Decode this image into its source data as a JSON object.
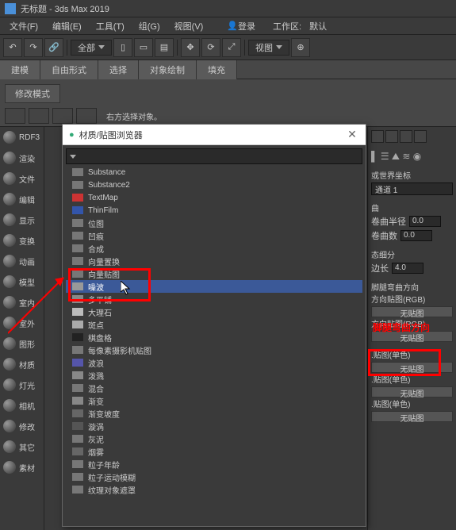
{
  "window": {
    "title": "无标题 - 3ds Max 2019"
  },
  "menu": {
    "file": "文件(F)",
    "edit": "编辑(E)",
    "tools": "工具(T)",
    "group": "组(G)",
    "views": "视图(V)",
    "login": "登录",
    "workspace": "工作区:",
    "default": "默认"
  },
  "toolbar": {
    "all_dropdown": "全部",
    "view_dropdown": "视图"
  },
  "ribbon": {
    "tab_build": "建模",
    "tab_freeform": "自由形式",
    "tab_select": "选择",
    "tab_objcontrol": "对象绘制",
    "tab_fill": "填充",
    "mod_mode": "修改模式",
    "mod_hint": "右方选择对象。"
  },
  "dialog": {
    "title": "材质/贴图浏览器",
    "maps": [
      "Substance",
      "Substance2",
      "TextMap",
      "ThinFilm",
      "位图",
      "凹痕",
      "合成",
      "向量置换",
      "向量贴图",
      "噪波",
      "多平铺",
      "大理石",
      "斑点",
      "棋盘格",
      "每像素摄影机贴图",
      "波浪",
      "泼溅",
      "混合",
      "渐变",
      "渐变坡度",
      "漩涡",
      "灰泥",
      "烟雾",
      "粒子年龄",
      "粒子运动模糊",
      "纹理对象遮罩"
    ],
    "selected_index": 9
  },
  "left": {
    "items": [
      "RDF3",
      "渲染",
      "文件",
      "编辑",
      "显示",
      "变换",
      "动画",
      "模型",
      "室内",
      "室外",
      "图形",
      "材质",
      "灯光",
      "相机",
      "修改",
      "其它",
      "素材"
    ]
  },
  "right": {
    "gen_world": "或世界坐标",
    "channel": "通道 1",
    "warp": "曲",
    "warp_radius": "卷曲半径",
    "warp_count": "卷曲数",
    "val_zero": "0.0",
    "subdiv": "态细分",
    "edge": "边长",
    "val_four": "4.0",
    "bump_dir": "脚腿弯曲方向",
    "slot1_hdr": "方向贴图(RGB)",
    "slot2_hdr": "方向贴图(RGB)",
    "single_a": ".贴图(单色)",
    "single_b": ".贴图(单色)",
    "single_c": ".贴图(单色)",
    "no_map": "无贴图"
  }
}
